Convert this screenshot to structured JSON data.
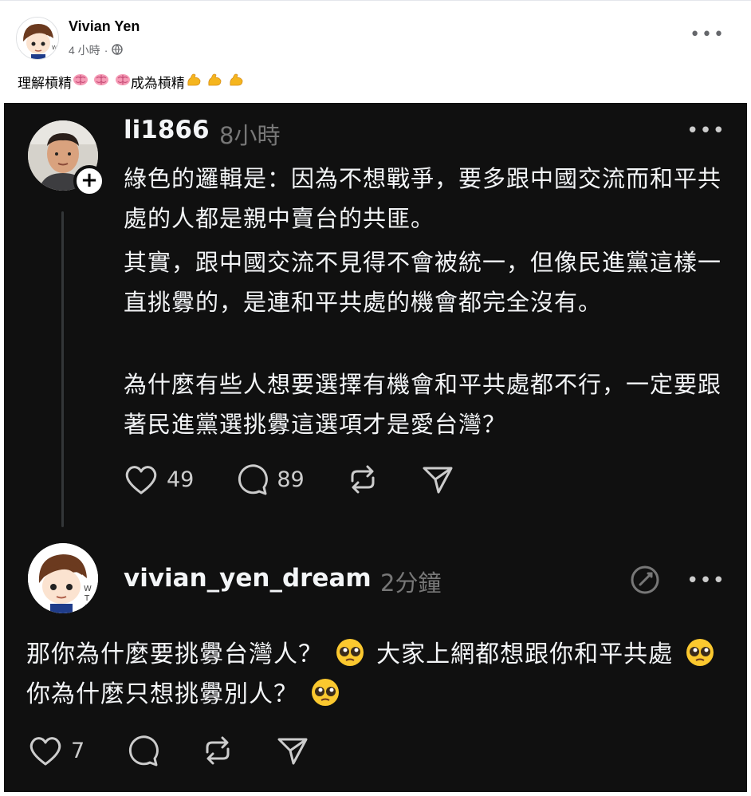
{
  "facebook_post": {
    "author": "Vivian Yen",
    "time": "4 小時",
    "dot": "·",
    "text": "理解槓精",
    "text_mid": "成為槓精",
    "emoji_1": "brain-emoji",
    "emoji_2": "flexed-biceps-emoji",
    "more": "•••"
  },
  "threads": {
    "post": {
      "username": "li1866",
      "time": "8小時",
      "more": "•••",
      "plus": "+",
      "paragraphs": [
        "綠色的邏輯是：因為不想戰爭，要多跟中國交流而和平共處的人都是親中賣台的共匪。",
        "其實，跟中國交流不見得不會被統一，但像民進黨這樣一直挑釁的，是連和平共處的機會都完全沒有。",
        "為什麼有些人想要選擇有機會和平共處都不行，一定要跟著民進黨選挑釁這選項才是愛台灣？"
      ],
      "likes": "49",
      "comments": "89"
    },
    "reply": {
      "username": "vivian_yen_dream",
      "time": "2分鐘",
      "more": "•••",
      "text_part1": "那你為什麼要挑釁台灣人？",
      "text_part2": "大家上網都想跟你和平共處",
      "text_part3": "你為什麼只想挑釁別人？",
      "likes": "7"
    }
  },
  "colors": {
    "threads_bg": "#101010",
    "text_light": "#f3f5f7",
    "muted": "#777777",
    "fb_secondary": "#65676b"
  }
}
